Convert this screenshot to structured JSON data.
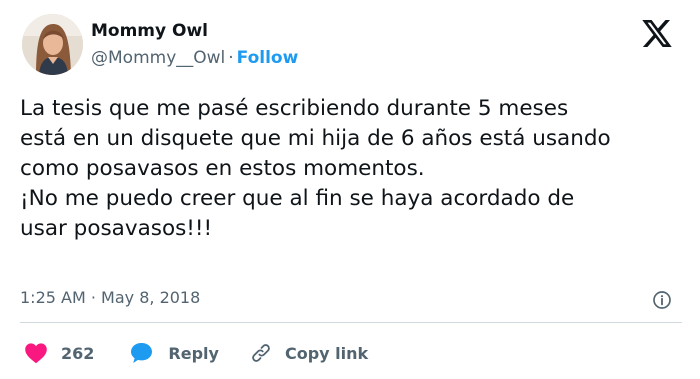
{
  "author": {
    "name": "Mommy Owl",
    "handle": "@Mommy__Owl",
    "separator": "·",
    "follow_label": "Follow"
  },
  "tweet": {
    "lines": [
      "La tesis que me pasé escribiendo durante 5 meses",
      "está en un disquete que mi hija de 6 años está usando",
      "como posavasos en estos momentos.",
      "¡No me puedo creer que al fin se haya acordado de",
      "usar posavasos!!!"
    ],
    "time": "1:25 AM",
    "separator": "·",
    "date": "May 8, 2018"
  },
  "actions": {
    "like_count": "262",
    "reply_label": "Reply",
    "copy_label": "Copy link"
  },
  "icons": {
    "platform": "x-logo-icon",
    "info": "info-icon",
    "like": "heart-icon",
    "reply": "speech-bubble-icon",
    "copy": "link-icon"
  },
  "colors": {
    "text": "#0f1419",
    "secondary": "#536471",
    "accent": "#1d9bf0",
    "like": "#f91880",
    "divider": "#cfd9de"
  }
}
